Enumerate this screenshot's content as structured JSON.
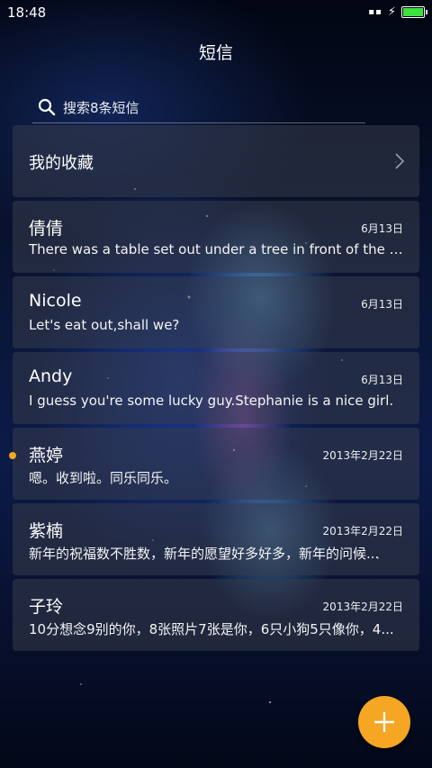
{
  "status": {
    "time": "18:48"
  },
  "header": {
    "title": "短信"
  },
  "search": {
    "placeholder": "搜索8条短信"
  },
  "favorites": {
    "label": "我的收藏"
  },
  "conversations": [
    {
      "name": "倩倩",
      "date": "6月13日",
      "preview": "There was a table set out under a tree in front of the ho...",
      "unread": false
    },
    {
      "name": "Nicole",
      "date": "6月13日",
      "preview": "Let's eat out,shall we?",
      "unread": false
    },
    {
      "name": "Andy",
      "date": "6月13日",
      "preview": "I guess you're some lucky guy.Stephanie is a nice girl.",
      "unread": false
    },
    {
      "name": "燕婷",
      "date": "2013年2月22日",
      "preview": "嗯。收到啦。同乐同乐。",
      "unread": true
    },
    {
      "name": "紫楠",
      "date": "2013年2月22日",
      "preview": "新年的祝福数不胜数，新年的愿望好多好多，新年的问候...",
      "unread": false
    },
    {
      "name": "子玲",
      "date": "2013年2月22日",
      "preview": "10分想念9别的你，8张照片7张是你，6只小狗5只像你，4...",
      "unread": false
    }
  ],
  "colors": {
    "accent": "#f5a623",
    "battery": "#3ee03e"
  },
  "icons": {
    "search": "search-icon",
    "chevron": "chevron-right-icon",
    "fab": "plus-icon"
  }
}
